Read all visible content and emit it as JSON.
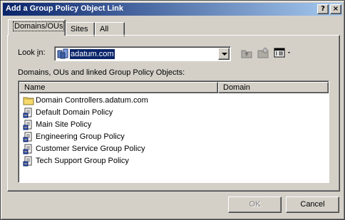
{
  "window": {
    "title": "Add a Group Policy Object Link"
  },
  "titlebar_buttons": {
    "help": "?",
    "close": "×"
  },
  "tabs": [
    {
      "label": "Domains/OUs"
    },
    {
      "label": "Sites"
    },
    {
      "label": "All"
    }
  ],
  "look_in": {
    "label_pre": "Look ",
    "label_accel": "i",
    "label_post": "n:",
    "value": "adatum.com"
  },
  "list_caption": "Domains, OUs and linked Group Policy Objects:",
  "columns": [
    {
      "label": "Name"
    },
    {
      "label": "Domain"
    }
  ],
  "items": [
    {
      "name": "Domain Controllers.adatum.com",
      "icon": "folder-icon"
    },
    {
      "name": "Default Domain Policy",
      "icon": "gpo-scroll-icon"
    },
    {
      "name": "Main Site Policy",
      "icon": "gpo-scroll-icon"
    },
    {
      "name": "Engineering Group Policy",
      "icon": "gpo-scroll-icon"
    },
    {
      "name": "Customer Service Group Policy",
      "icon": "gpo-scroll-icon"
    },
    {
      "name": "Tech Support Group Policy",
      "icon": "gpo-scroll-icon"
    }
  ],
  "toolbar_icons": [
    "up-one-level-icon",
    "new-ou-icon",
    "view-menu-icon"
  ],
  "buttons": {
    "ok": "OK",
    "cancel": "Cancel"
  },
  "colors": {
    "title_start": "#0a246a",
    "title_end": "#a6caf0",
    "face": "#d4d0c8",
    "selection": "#0a246a"
  }
}
